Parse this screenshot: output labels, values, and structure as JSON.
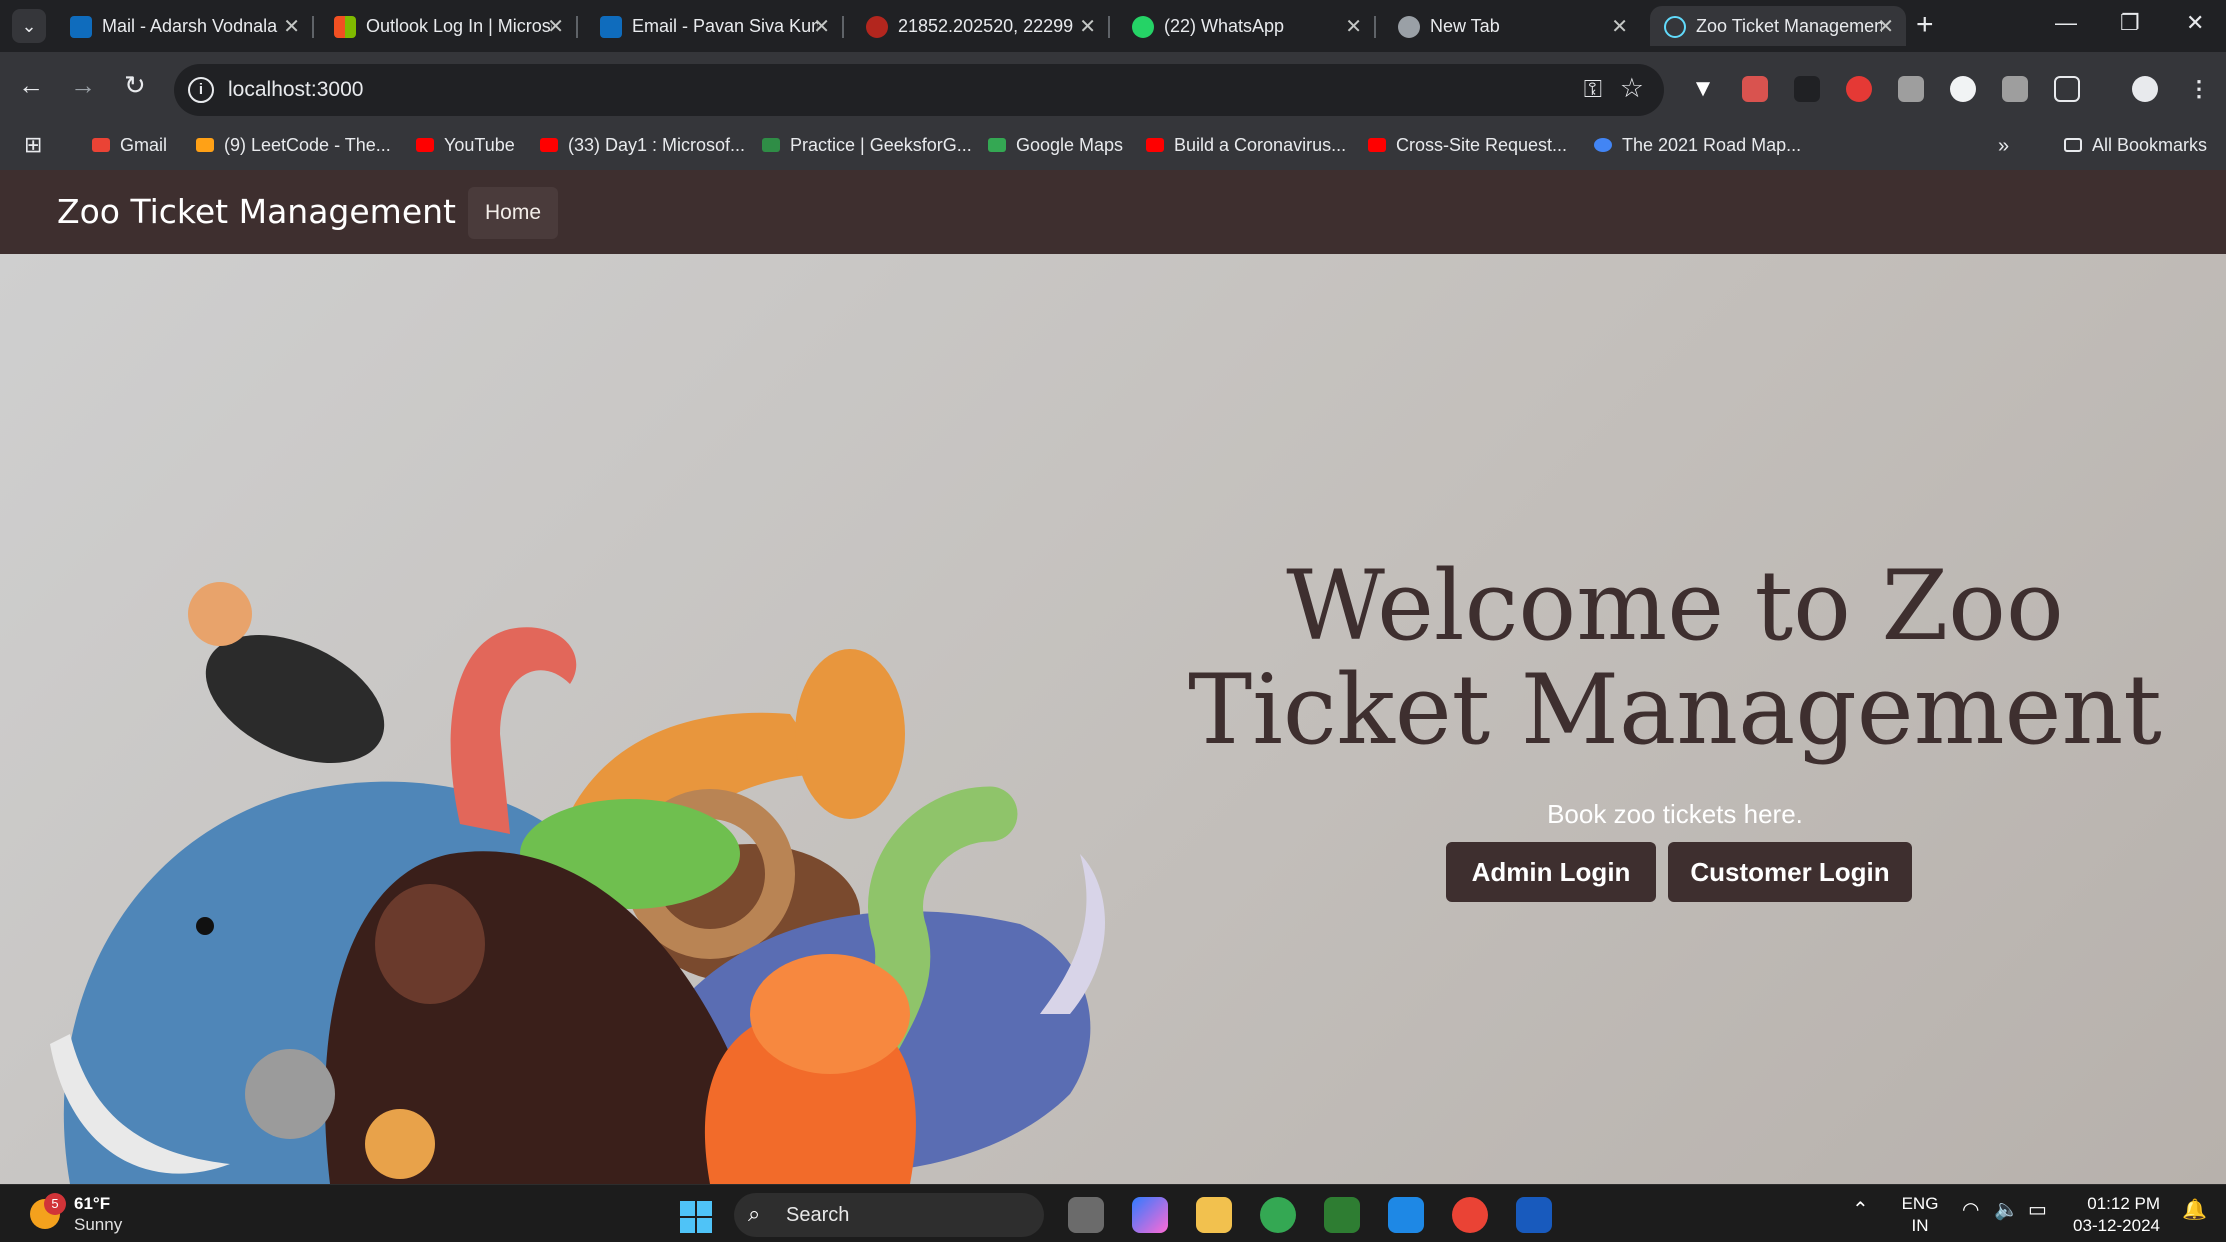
{
  "browser": {
    "tabs": [
      {
        "title": "Mail - Adarsh Vodnala",
        "icon": "outlook-icon",
        "color": "#0f6cbd"
      },
      {
        "title": "Outlook Log In | Microsoft",
        "icon": "microsoft-icon",
        "color": "#f25022"
      },
      {
        "title": "Email - Pavan Siva Kumar",
        "icon": "outlook-icon",
        "color": "#0f6cbd"
      },
      {
        "title": "21852.202520, 22299",
        "icon": "banner-icon",
        "color": "#b3261e"
      },
      {
        "title": "(22) WhatsApp",
        "icon": "whatsapp-icon",
        "color": "#25d366"
      },
      {
        "title": "New Tab",
        "icon": "chrome-icon",
        "color": "#9aa0a6"
      },
      {
        "title": "Zoo Ticket Management",
        "icon": "react-icon",
        "color": "#61dafb",
        "active": true
      }
    ],
    "url": "localhost:3000",
    "bookmarks": [
      {
        "label": "Gmail",
        "color": "#ea4335"
      },
      {
        "label": "(9) LeetCode - The...",
        "color": "#ffa116"
      },
      {
        "label": "YouTube",
        "color": "#ff0000"
      },
      {
        "label": "(33) Day1 : Microsof...",
        "color": "#ff0000"
      },
      {
        "label": "Practice | GeeksforG...",
        "color": "#2f8d46"
      },
      {
        "label": "Google Maps",
        "color": "#34a853"
      },
      {
        "label": "Build a Coronavirus...",
        "color": "#ff0000"
      },
      {
        "label": "Cross-Site Request...",
        "color": "#ff0000"
      },
      {
        "label": "The 2021 Road Map...",
        "color": "#4285f4"
      }
    ],
    "all_bookmarks": "All Bookmarks"
  },
  "app": {
    "brand": "Zoo Ticket Management",
    "nav": {
      "home": "Home"
    },
    "hero": {
      "title": "Welcome to Zoo Ticket Management",
      "subtitle": "Book zoo tickets here.",
      "admin_button": "Admin Login",
      "customer_button": "Customer Login"
    },
    "colors": {
      "primary": "#3e2f2f",
      "background": "#c3bfbb"
    }
  },
  "taskbar": {
    "weather": {
      "temp": "61°F",
      "condition": "Sunny",
      "badge": "5"
    },
    "search_placeholder": "Search",
    "lang": "ENG",
    "region": "IN",
    "time": "01:12 PM",
    "date": "03-12-2024"
  }
}
